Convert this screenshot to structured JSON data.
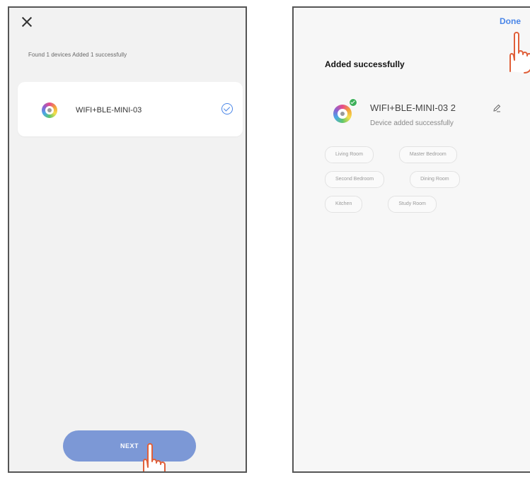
{
  "left_screen": {
    "found_text": "Found 1 devices  Added 1 successfully",
    "device": {
      "name": "WIFI+BLE-MINI-03",
      "icon": "rainbow-bulb-icon",
      "status_icon": "check-circle-icon"
    },
    "next_label": "NEXT"
  },
  "right_screen": {
    "done_label": "Done",
    "title": "Added successfully",
    "device": {
      "name": "WIFI+BLE-MINI-03 2",
      "status": "Device added successfully",
      "icon": "rainbow-bulb-icon"
    },
    "rooms": [
      [
        "Living Room",
        "Master Bedroom"
      ],
      [
        "Second Bedroom",
        "Dining Room"
      ],
      [
        "Kitchen",
        "Study Room"
      ]
    ]
  },
  "colors": {
    "accent_blue": "#4a86e8",
    "next_button": "#7c98d6",
    "success_green": "#3db05a",
    "pointer_hand": "#e0603a"
  }
}
